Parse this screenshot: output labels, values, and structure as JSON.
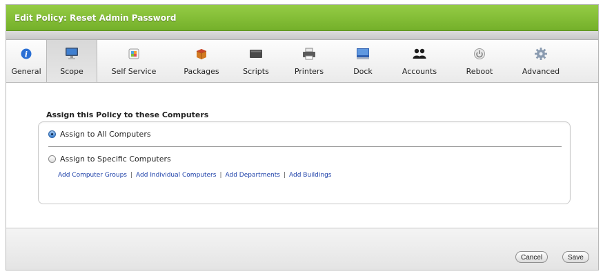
{
  "window": {
    "title": "Edit Policy: Reset Admin Password"
  },
  "tabs": [
    {
      "label": "General",
      "icon": "info-icon"
    },
    {
      "label": "Scope",
      "icon": "monitor-icon",
      "selected": true
    },
    {
      "label": "Self Service",
      "icon": "self-service-icon"
    },
    {
      "label": "Packages",
      "icon": "package-icon"
    },
    {
      "label": "Scripts",
      "icon": "script-icon"
    },
    {
      "label": "Printers",
      "icon": "printer-icon"
    },
    {
      "label": "Dock",
      "icon": "dock-icon"
    },
    {
      "label": "Accounts",
      "icon": "accounts-icon"
    },
    {
      "label": "Reboot",
      "icon": "reboot-icon"
    },
    {
      "label": "Advanced",
      "icon": "gear-icon"
    }
  ],
  "scope": {
    "heading": "Assign this Policy to these Computers",
    "options": [
      {
        "label": "Assign to All Computers",
        "checked": true
      },
      {
        "label": "Assign to Specific Computers",
        "checked": false
      }
    ],
    "links": [
      "Add Computer Groups",
      "Add Individual Computers",
      "Add Departments",
      "Add Buildings"
    ],
    "link_separator": "|"
  },
  "footer": {
    "cancel_label": "Cancel",
    "save_label": "Save"
  },
  "colors": {
    "titlebar": "#7fb834",
    "link": "#1a3ea8"
  }
}
